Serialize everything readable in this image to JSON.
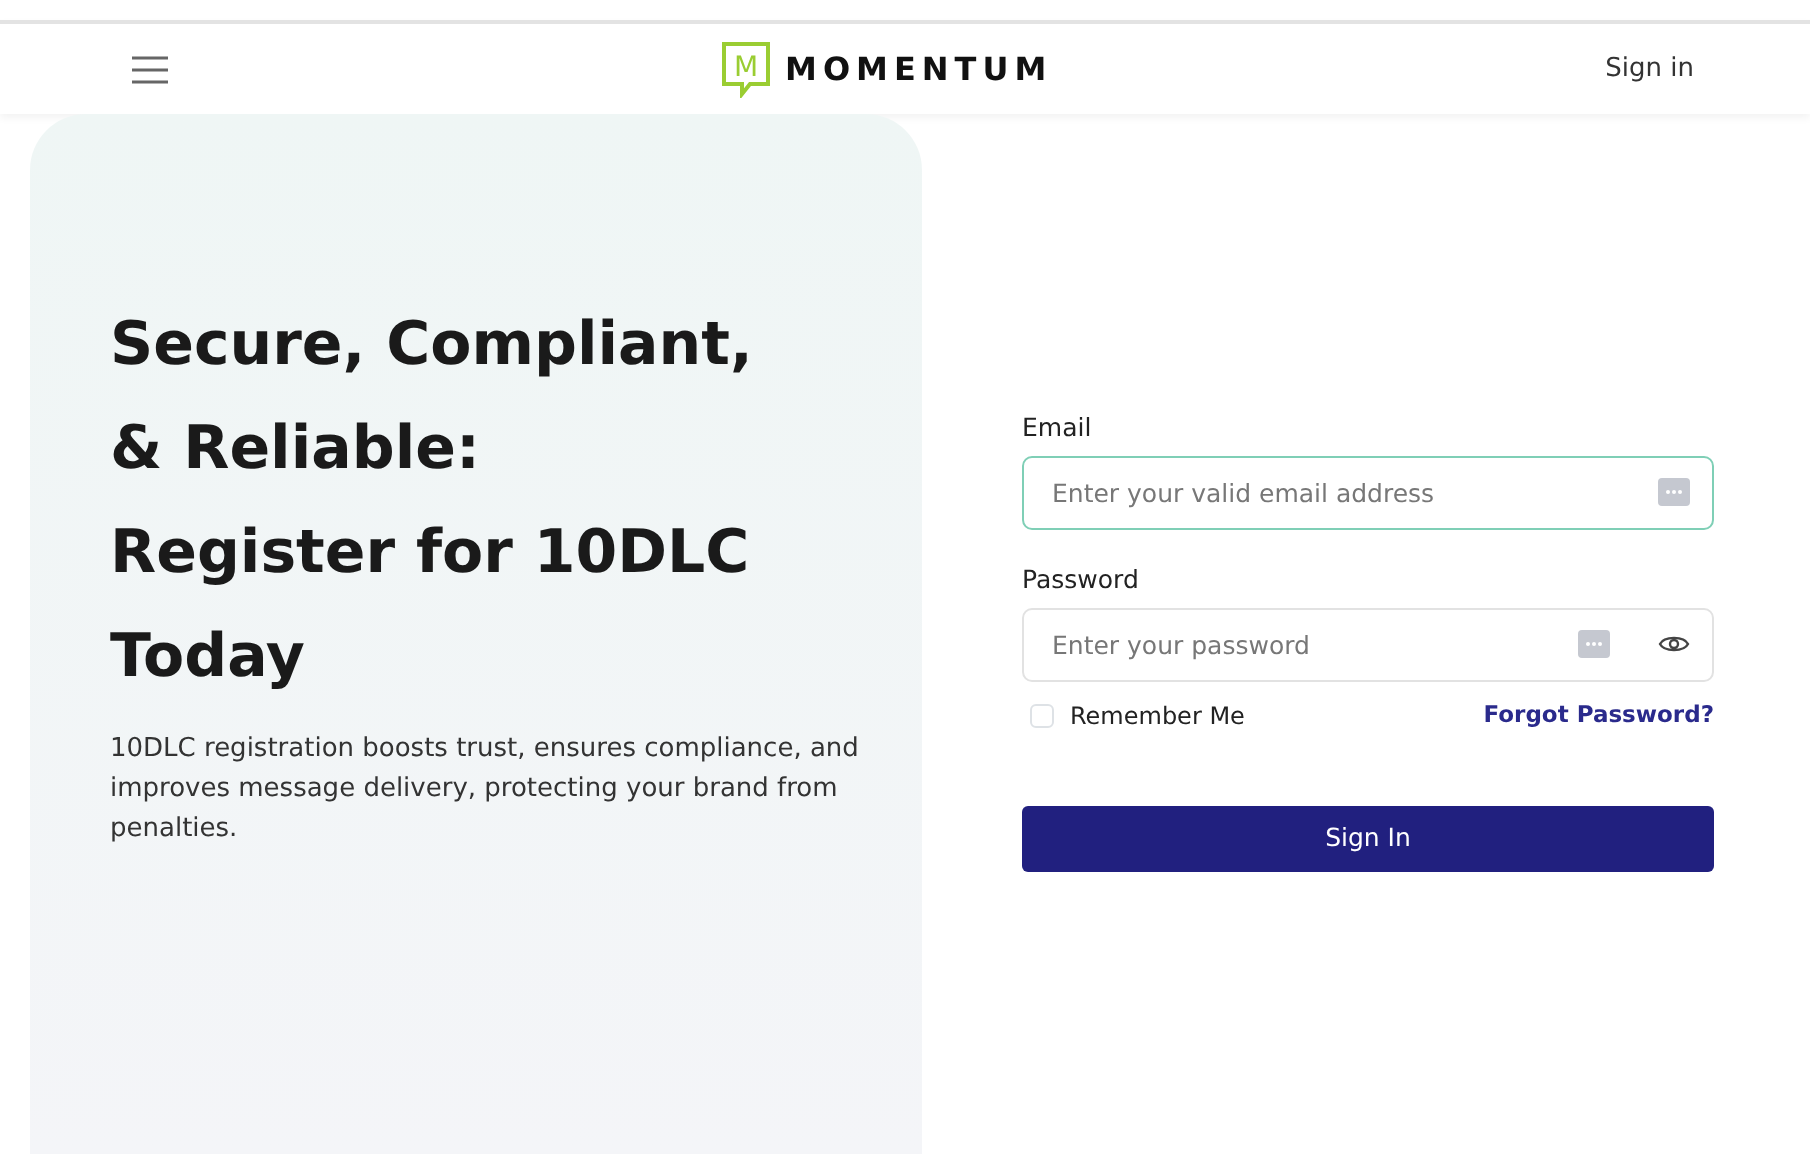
{
  "header": {
    "brand_mark": "M",
    "brand": "MOMENTUM",
    "sign_in_link": "Sign in"
  },
  "hero": {
    "heading_lines": [
      "Secure, Compliant,",
      "& Reliable:",
      "Register for 10DLC",
      "Today"
    ],
    "description": "10DLC registration boosts trust, ensures compliance, and improves message delivery, protecting your brand from penalties."
  },
  "form": {
    "fields": [
      {
        "kind": "email",
        "label": "Email",
        "placeholder": "Enter your valid email address",
        "focused": true
      },
      {
        "kind": "password",
        "label": "Password",
        "placeholder": "Enter your password",
        "focused": false
      }
    ],
    "remember": {
      "label": "Remember Me",
      "checked": false
    },
    "forgot_link": "Forgot Password?",
    "submit": "Sign In"
  }
}
